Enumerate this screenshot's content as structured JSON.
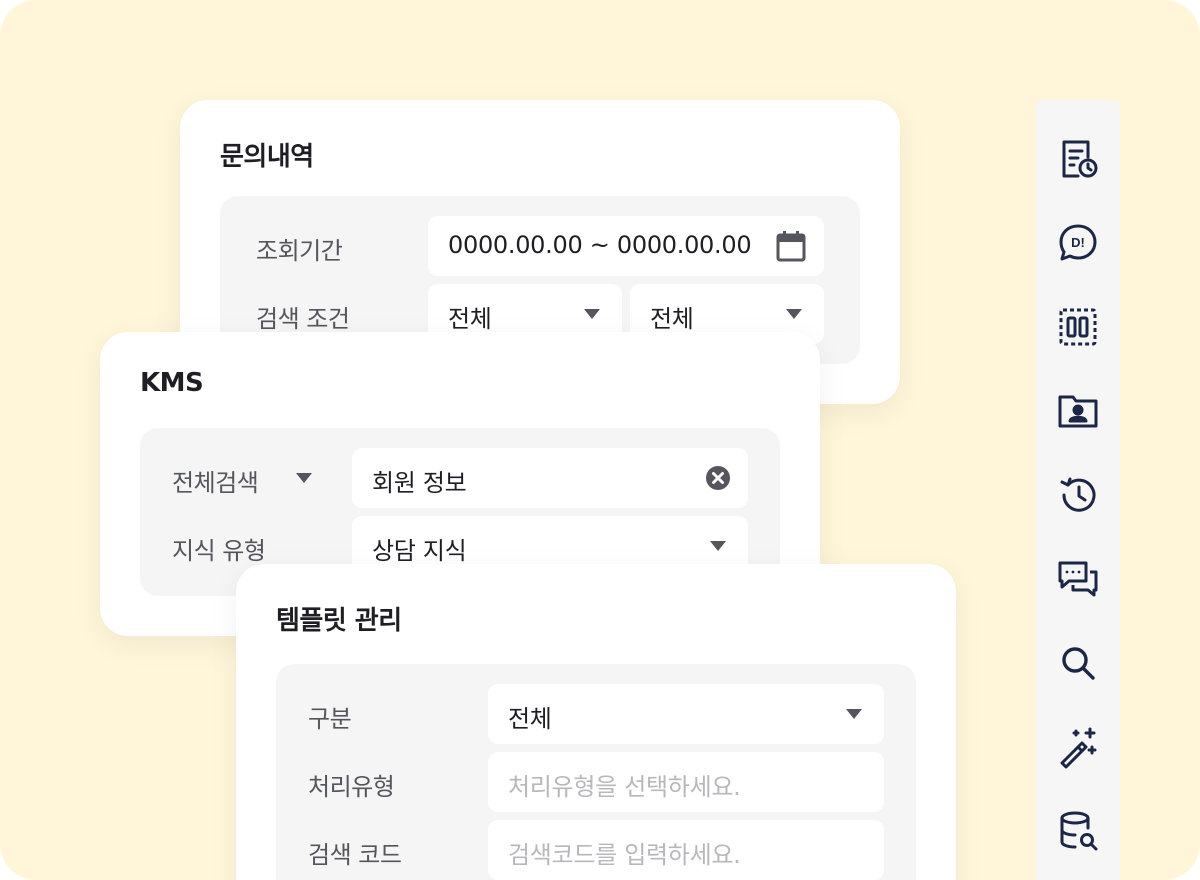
{
  "inquiry": {
    "title": "문의내역",
    "period_label": "조회기간",
    "period_value": "0000.00.00 ~ 0000.00.00",
    "criteria_label": "검색 조건",
    "criteria_select1": "전체",
    "criteria_select2": "전체"
  },
  "kms": {
    "title": "KMS",
    "search_scope": "전체검색",
    "search_value": "회원 정보",
    "type_label": "지식 유형",
    "type_value": "상담 지식"
  },
  "template": {
    "title": "템플릿 관리",
    "category_label": "구분",
    "category_value": "전체",
    "process_label": "처리유형",
    "process_placeholder": "처리유형을 선택하세요.",
    "code_label": "검색 코드",
    "code_placeholder": "검색코드를 입력하세요."
  },
  "sidebar": {
    "items": [
      {
        "icon": "inquiry-history-icon"
      },
      {
        "icon": "chat-dialog-icon"
      },
      {
        "icon": "dashed-panel-icon"
      },
      {
        "icon": "contact-folder-icon"
      },
      {
        "icon": "history-icon"
      },
      {
        "icon": "conversation-icon"
      },
      {
        "icon": "search-icon"
      },
      {
        "icon": "magic-wand-icon"
      },
      {
        "icon": "database-search-icon"
      }
    ]
  },
  "colors": {
    "background": "#fff5d9",
    "icon": "#1c2747",
    "text": "#1e1e24",
    "label": "#55555d",
    "placeholder": "#b8b8bc"
  }
}
